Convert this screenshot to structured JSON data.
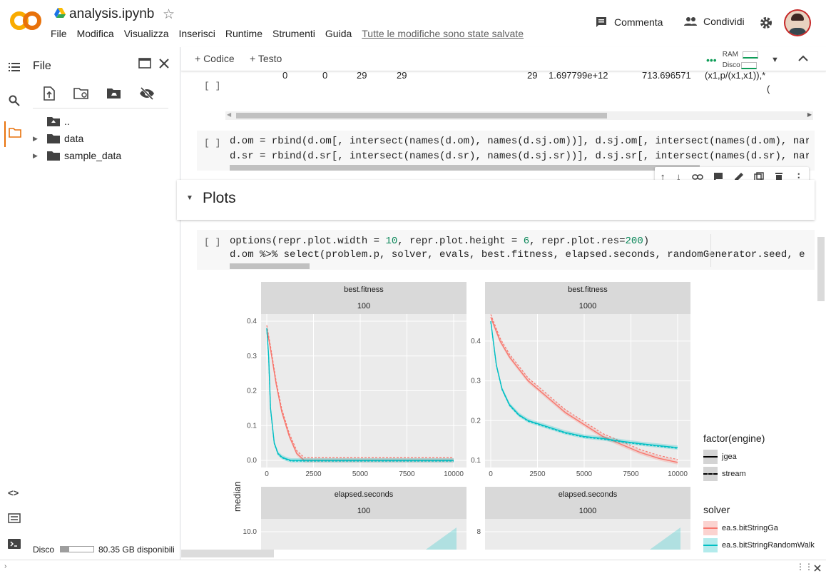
{
  "header": {
    "title": "analysis.ipynb",
    "menu": [
      "File",
      "Modifica",
      "Visualizza",
      "Inserisci",
      "Runtime",
      "Strumenti",
      "Guida"
    ],
    "saved_status": "Tutte le modifiche sono state salvate",
    "comment_label": "Commenta",
    "share_label": "Condividi",
    "logo_text": "CO"
  },
  "sidebar": {
    "title": "File",
    "tree": [
      {
        "label": ".."
      },
      {
        "label": "data"
      },
      {
        "label": "sample_data"
      }
    ],
    "disk_label": "Disco",
    "disk_free": "80.35 GB disponibili"
  },
  "toolbar": {
    "code_label": "+ Codice",
    "text_label": "+ Testo",
    "ram_label": "RAM",
    "disk_label": "Disco"
  },
  "output_row": {
    "values": [
      "0",
      "0",
      "29",
      "29",
      "29",
      "1.697799e+12",
      "713.696571",
      "(x1,p/(x1,x1)),*",
      "("
    ]
  },
  "cell1": {
    "bracket": "[ ]",
    "lines": [
      "d.om = rbind(d.om[, intersect(names(d.om), names(d.sj.om))], d.sj.om[, intersect(names(d.om), nar",
      "d.sr = rbind(d.sr[, intersect(names(d.sr), names(d.sj.sr))], d.sj.sr[, intersect(names(d.sr), nar"
    ]
  },
  "section": {
    "title": "Plots"
  },
  "cell2": {
    "bracket": "[ ]",
    "line1_parts": [
      "options(repr.plot.width = ",
      "10",
      ", repr.plot.height = ",
      "6",
      ", repr.plot.res=",
      "200",
      ")"
    ],
    "line2": "d.om %>% select(problem.p, solver, evals, best.fitness, elapsed.seconds, randomGenerator.seed, e"
  },
  "figure": {
    "ylabel": "median",
    "panels": [
      {
        "strip_top": "best.fitness",
        "strip_sub": "100"
      },
      {
        "strip_top": "best.fitness",
        "strip_sub": "1000"
      },
      {
        "strip_top": "elapsed.seconds",
        "strip_sub": "100"
      },
      {
        "strip_top": "elapsed.seconds",
        "strip_sub": "1000"
      }
    ],
    "legend_engine_title": "factor(engine)",
    "legend_engine": [
      "jgea",
      "stream"
    ],
    "legend_solver_title": "solver",
    "legend_solver": [
      "ea.s.bitStringGa",
      "ea.s.bitStringRandomWalk"
    ],
    "colors": {
      "ga": "#f8766d",
      "rw": "#00bfc4"
    }
  },
  "chart_data": [
    {
      "type": "line",
      "title": "best.fitness 100",
      "xlim": [
        0,
        10000
      ],
      "ylim": [
        0,
        0.4
      ],
      "x_ticks": [
        "0",
        "2500",
        "5000",
        "7500",
        "10000"
      ],
      "y_ticks": [
        "0.0",
        "0.1",
        "0.2",
        "0.3",
        "0.4"
      ],
      "series": [
        {
          "name": "ea.s.bitStringGa",
          "x": [
            0,
            200,
            500,
            800,
            1200,
            1600,
            2000,
            10000
          ],
          "values": [
            0.38,
            0.32,
            0.22,
            0.14,
            0.07,
            0.02,
            0.0,
            0.0
          ]
        },
        {
          "name": "ea.s.bitStringRandomWalk",
          "x": [
            0,
            100,
            200,
            400,
            600,
            800,
            1000,
            1300,
            10000
          ],
          "values": [
            0.38,
            0.3,
            0.15,
            0.05,
            0.02,
            0.01,
            0.005,
            0.0,
            0.0
          ]
        }
      ]
    },
    {
      "type": "line",
      "title": "best.fitness 1000",
      "xlim": [
        0,
        10000
      ],
      "ylim": [
        0.1,
        0.45
      ],
      "x_ticks": [
        "0",
        "2500",
        "5000",
        "7500",
        "10000"
      ],
      "y_ticks": [
        "0.1",
        "0.2",
        "0.3",
        "0.4"
      ],
      "series": [
        {
          "name": "ea.s.bitStringGa",
          "x": [
            0,
            500,
            1000,
            2000,
            3000,
            4000,
            5000,
            6000,
            7000,
            8000,
            9000,
            10000
          ],
          "values": [
            0.46,
            0.4,
            0.36,
            0.3,
            0.26,
            0.22,
            0.19,
            0.16,
            0.14,
            0.12,
            0.105,
            0.095
          ]
        },
        {
          "name": "ea.s.bitStringRandomWalk",
          "x": [
            0,
            300,
            600,
            1000,
            1500,
            2000,
            3000,
            4000,
            5000,
            6000,
            7000,
            8000,
            9000,
            10000
          ],
          "values": [
            0.45,
            0.34,
            0.28,
            0.24,
            0.215,
            0.2,
            0.185,
            0.17,
            0.16,
            0.155,
            0.148,
            0.142,
            0.137,
            0.132
          ]
        }
      ]
    },
    {
      "type": "area",
      "title": "elapsed.seconds 100",
      "y_ticks": [
        "10.0"
      ]
    },
    {
      "type": "area",
      "title": "elapsed.seconds 1000",
      "y_ticks": [
        "8"
      ]
    }
  ]
}
